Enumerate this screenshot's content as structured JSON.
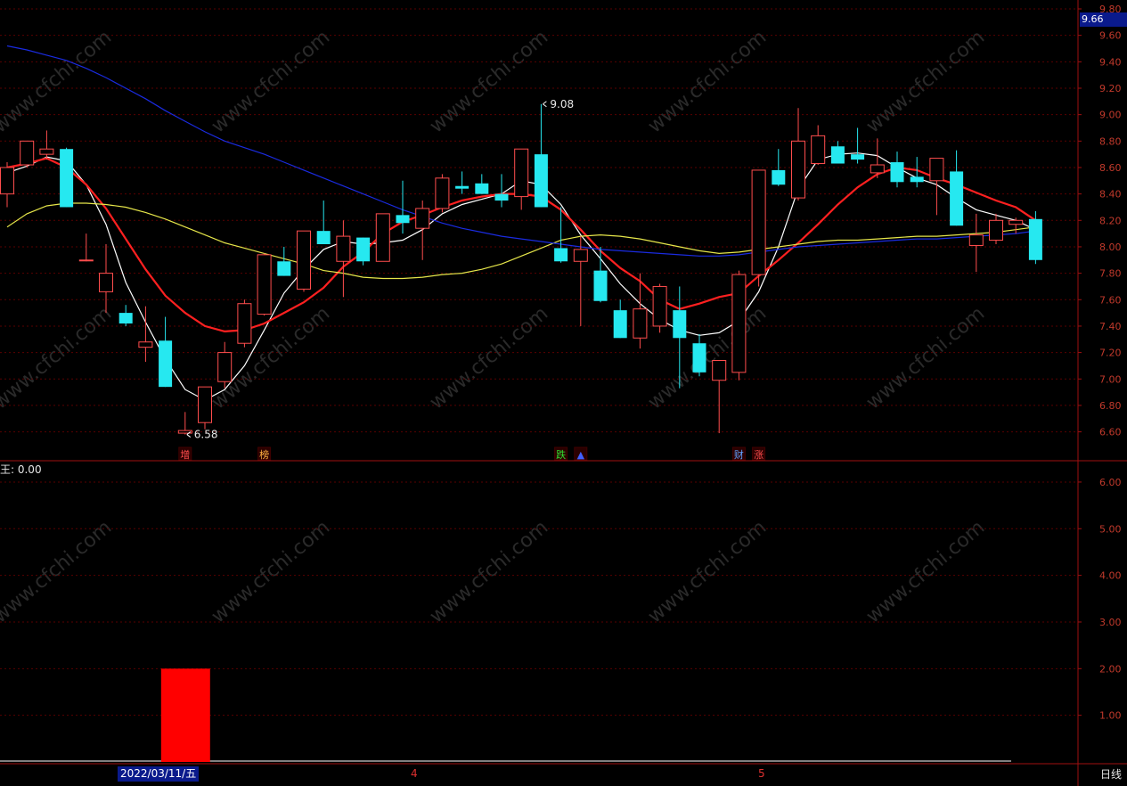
{
  "colors": {
    "background": "#000000",
    "up": "#ff4d4d",
    "down": "#26e8f0",
    "grid": "#5a0000",
    "ma_white": "#ffffff",
    "ma_red": "#ff2020",
    "ma_yellow": "#e6e64a",
    "ma_blue": "#1a2be0",
    "volume_bar": "#ff0000"
  },
  "header": {
    "last_price": "9.66"
  },
  "indicator": {
    "label": "王: 0.00"
  },
  "footer": {
    "date_label": "2022/03/11/五",
    "month_4": "4",
    "month_5": "5",
    "period": "日线"
  },
  "chart_data": [
    {
      "type": "candlestick",
      "price_axis": {
        "ticks": [
          "9.80",
          "9.60",
          "9.40",
          "9.20",
          "9.00",
          "8.80",
          "8.60",
          "8.40",
          "8.20",
          "8.00",
          "7.80",
          "7.60",
          "7.40",
          "7.20",
          "7.00",
          "6.80",
          "6.60"
        ],
        "range": [
          6.55,
          9.8
        ]
      },
      "annotations": [
        {
          "text": "9.08",
          "price": 9.08,
          "index": 27
        },
        {
          "text": "6.58",
          "price": 6.58,
          "index": 9
        }
      ],
      "event_tags": [
        {
          "text": "增",
          "index": 9,
          "color": "#ff4d4d"
        },
        {
          "text": "榜",
          "index": 13,
          "color": "#ffb040"
        },
        {
          "text": "跌",
          "index": 28,
          "color": "#30e030"
        },
        {
          "text": "▲",
          "index": 29,
          "color": "#4060ff"
        },
        {
          "text": "财",
          "index": 37,
          "color": "#60a0ff"
        },
        {
          "text": "涨",
          "index": 38,
          "color": "#ff4d4d"
        }
      ],
      "candles": [
        {
          "o": 8.4,
          "h": 8.64,
          "l": 8.3,
          "c": 8.6
        },
        {
          "o": 8.62,
          "h": 8.8,
          "l": 8.6,
          "c": 8.8
        },
        {
          "o": 8.7,
          "h": 8.88,
          "l": 8.66,
          "c": 8.74
        },
        {
          "o": 8.74,
          "h": 8.75,
          "l": 8.3,
          "c": 8.3
        },
        {
          "o": 7.9,
          "h": 8.1,
          "l": 7.89,
          "c": 7.9
        },
        {
          "o": 7.66,
          "h": 8.02,
          "l": 7.5,
          "c": 7.8
        },
        {
          "o": 7.5,
          "h": 7.56,
          "l": 7.4,
          "c": 7.42
        },
        {
          "o": 7.24,
          "h": 7.55,
          "l": 7.13,
          "c": 7.28
        },
        {
          "o": 7.29,
          "h": 7.47,
          "l": 6.94,
          "c": 6.94
        },
        {
          "o": 6.59,
          "h": 6.75,
          "l": 6.58,
          "c": 6.61
        },
        {
          "o": 6.67,
          "h": 6.94,
          "l": 6.62,
          "c": 6.94
        },
        {
          "o": 6.98,
          "h": 7.28,
          "l": 6.93,
          "c": 7.2
        },
        {
          "o": 7.27,
          "h": 7.6,
          "l": 7.24,
          "c": 7.57
        },
        {
          "o": 7.49,
          "h": 7.95,
          "l": 7.48,
          "c": 7.94
        },
        {
          "o": 7.89,
          "h": 8.0,
          "l": 7.78,
          "c": 7.78
        },
        {
          "o": 7.68,
          "h": 8.12,
          "l": 7.66,
          "c": 8.12
        },
        {
          "o": 8.12,
          "h": 8.35,
          "l": 8.02,
          "c": 8.02
        },
        {
          "o": 7.89,
          "h": 8.2,
          "l": 7.62,
          "c": 8.08
        },
        {
          "o": 8.07,
          "h": 8.07,
          "l": 7.86,
          "c": 7.89
        },
        {
          "o": 7.89,
          "h": 8.25,
          "l": 7.89,
          "c": 8.25
        },
        {
          "o": 8.24,
          "h": 8.5,
          "l": 8.1,
          "c": 8.18
        },
        {
          "o": 8.14,
          "h": 8.35,
          "l": 7.9,
          "c": 8.29
        },
        {
          "o": 8.29,
          "h": 8.55,
          "l": 8.26,
          "c": 8.52
        },
        {
          "o": 8.46,
          "h": 8.57,
          "l": 8.4,
          "c": 8.44
        },
        {
          "o": 8.48,
          "h": 8.55,
          "l": 8.4,
          "c": 8.4
        },
        {
          "o": 8.4,
          "h": 8.55,
          "l": 8.3,
          "c": 8.35
        },
        {
          "o": 8.38,
          "h": 8.74,
          "l": 8.28,
          "c": 8.74
        },
        {
          "o": 8.7,
          "h": 9.08,
          "l": 8.3,
          "c": 8.3
        },
        {
          "o": 7.99,
          "h": 8.3,
          "l": 7.88,
          "c": 7.89
        },
        {
          "o": 7.89,
          "h": 8.08,
          "l": 7.4,
          "c": 7.98
        },
        {
          "o": 7.82,
          "h": 8.0,
          "l": 7.58,
          "c": 7.59
        },
        {
          "o": 7.52,
          "h": 7.6,
          "l": 7.31,
          "c": 7.31
        },
        {
          "o": 7.31,
          "h": 7.8,
          "l": 7.23,
          "c": 7.53
        },
        {
          "o": 7.4,
          "h": 7.72,
          "l": 7.35,
          "c": 7.7
        },
        {
          "o": 7.52,
          "h": 7.7,
          "l": 6.93,
          "c": 7.31
        },
        {
          "o": 7.27,
          "h": 7.34,
          "l": 7.02,
          "c": 7.05
        },
        {
          "o": 6.99,
          "h": 7.13,
          "l": 6.59,
          "c": 7.14
        },
        {
          "o": 7.05,
          "h": 7.82,
          "l": 6.99,
          "c": 7.79
        },
        {
          "o": 7.79,
          "h": 8.58,
          "l": 7.7,
          "c": 8.58
        },
        {
          "o": 8.58,
          "h": 8.74,
          "l": 8.46,
          "c": 8.47
        },
        {
          "o": 8.37,
          "h": 9.05,
          "l": 8.35,
          "c": 8.8
        },
        {
          "o": 8.63,
          "h": 8.92,
          "l": 8.62,
          "c": 8.84
        },
        {
          "o": 8.76,
          "h": 8.8,
          "l": 8.65,
          "c": 8.63
        },
        {
          "o": 8.7,
          "h": 8.9,
          "l": 8.63,
          "c": 8.66
        },
        {
          "o": 8.56,
          "h": 8.82,
          "l": 8.52,
          "c": 8.62
        },
        {
          "o": 8.64,
          "h": 8.72,
          "l": 8.45,
          "c": 8.49
        },
        {
          "o": 8.53,
          "h": 8.68,
          "l": 8.45,
          "c": 8.49
        },
        {
          "o": 8.5,
          "h": 8.67,
          "l": 8.24,
          "c": 8.67
        },
        {
          "o": 8.57,
          "h": 8.73,
          "l": 8.16,
          "c": 8.16
        },
        {
          "o": 8.01,
          "h": 8.25,
          "l": 7.81,
          "c": 8.09
        },
        {
          "o": 8.05,
          "h": 8.25,
          "l": 8.02,
          "c": 8.2
        },
        {
          "o": 8.17,
          "h": 8.22,
          "l": 8.1,
          "c": 8.2
        },
        {
          "o": 8.21,
          "h": 8.27,
          "l": 7.87,
          "c": 7.9
        }
      ],
      "moving_averages": [
        {
          "color_key": "ma_white",
          "values": [
            8.56,
            8.61,
            8.68,
            8.65,
            8.47,
            8.17,
            7.73,
            7.43,
            7.15,
            6.92,
            6.84,
            6.92,
            7.1,
            7.37,
            7.65,
            7.83,
            7.98,
            8.04,
            8.02,
            8.03,
            8.05,
            8.13,
            8.25,
            8.32,
            8.36,
            8.4,
            8.5,
            8.47,
            8.32,
            8.09,
            7.91,
            7.72,
            7.57,
            7.45,
            7.37,
            7.33,
            7.35,
            7.44,
            7.66,
            8.0,
            8.44,
            8.66,
            8.7,
            8.71,
            8.69,
            8.6,
            8.52,
            8.47,
            8.37,
            8.28,
            8.24,
            8.2,
            8.13
          ]
        },
        {
          "color_key": "ma_red",
          "values": [
            8.6,
            8.63,
            8.67,
            8.6,
            8.47,
            8.29,
            8.06,
            7.83,
            7.63,
            7.5,
            7.4,
            7.36,
            7.37,
            7.42,
            7.5,
            7.58,
            7.69,
            7.85,
            7.96,
            8.1,
            8.19,
            8.24,
            8.3,
            8.35,
            8.38,
            8.4,
            8.4,
            8.38,
            8.28,
            8.13,
            7.97,
            7.84,
            7.74,
            7.6,
            7.53,
            7.57,
            7.62,
            7.65,
            7.78,
            7.9,
            8.03,
            8.17,
            8.32,
            8.45,
            8.55,
            8.6,
            8.58,
            8.52,
            8.47,
            8.41,
            8.35,
            8.3,
            8.2
          ]
        },
        {
          "color_key": "ma_yellow",
          "values": [
            8.15,
            8.25,
            8.31,
            8.33,
            8.33,
            8.32,
            8.3,
            8.26,
            8.21,
            8.15,
            8.09,
            8.03,
            7.99,
            7.95,
            7.91,
            7.87,
            7.82,
            7.8,
            7.77,
            7.76,
            7.76,
            7.77,
            7.79,
            7.8,
            7.83,
            7.87,
            7.93,
            7.99,
            8.05,
            8.08,
            8.09,
            8.08,
            8.06,
            8.03,
            8.0,
            7.97,
            7.95,
            7.96,
            7.98,
            8.0,
            8.02,
            8.04,
            8.05,
            8.05,
            8.06,
            8.07,
            8.08,
            8.08,
            8.09,
            8.1,
            8.11,
            8.13,
            8.15
          ]
        },
        {
          "color_key": "ma_blue",
          "values": [
            9.52,
            9.49,
            9.45,
            9.41,
            9.35,
            9.28,
            9.2,
            9.12,
            9.03,
            8.95,
            8.87,
            8.8,
            8.75,
            8.7,
            8.64,
            8.58,
            8.52,
            8.46,
            8.4,
            8.34,
            8.28,
            8.23,
            8.18,
            8.14,
            8.11,
            8.08,
            8.06,
            8.04,
            8.02,
            8.0,
            7.98,
            7.97,
            7.96,
            7.95,
            7.94,
            7.93,
            7.93,
            7.94,
            7.96,
            7.98,
            8.0,
            8.01,
            8.02,
            8.03,
            8.04,
            8.05,
            8.06,
            8.06,
            8.07,
            8.08,
            8.09,
            8.1,
            8.12
          ]
        }
      ]
    },
    {
      "type": "bar",
      "title": "王: 0.00",
      "y_axis_ticks": [
        "6.00",
        "5.00",
        "4.00",
        "3.00",
        "2.00",
        "1.00"
      ],
      "ylim": [
        0,
        6.4
      ],
      "bars": [
        {
          "index": 9,
          "value": 2.0
        }
      ]
    }
  ]
}
